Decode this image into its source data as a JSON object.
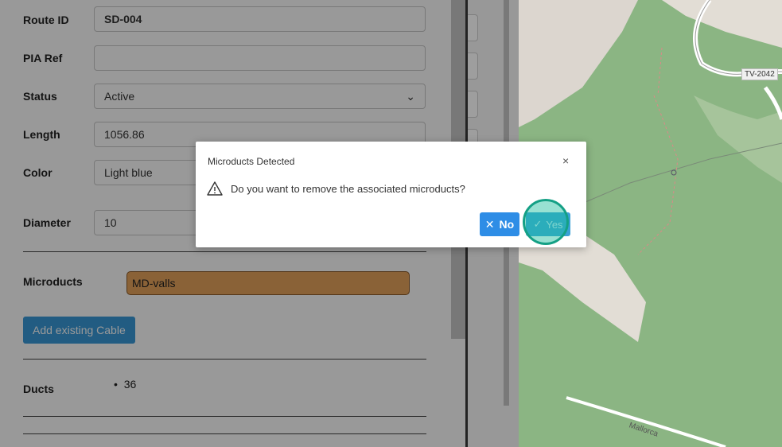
{
  "form": {
    "route_id": {
      "label": "Route ID",
      "value": "SD-004"
    },
    "pia_ref": {
      "label": "PIA Ref",
      "value": ""
    },
    "status": {
      "label": "Status",
      "value": "Active"
    },
    "length": {
      "label": "Length",
      "value": "1056.86"
    },
    "color": {
      "label": "Color",
      "value": "Light blue"
    },
    "diameter": {
      "label": "Diameter",
      "value": "10"
    },
    "microducts": {
      "label": "Microducts",
      "items": [
        "MD-valls"
      ]
    },
    "add_existing_cable": "Add existing Cable",
    "ducts": {
      "label": "Ducts",
      "items": [
        "36"
      ]
    }
  },
  "modal": {
    "title": "Microducts Detected",
    "message": "Do you want to remove the associated microducts?",
    "no_label": "No",
    "yes_label": "Yes",
    "close_glyph": "×"
  },
  "map": {
    "road_label": "TV-2042",
    "street_label": "Mallorca"
  },
  "colors": {
    "primary_button": "#2e8de6",
    "microduct_tag": "#e6a35c",
    "map_green": "#8bb583"
  }
}
